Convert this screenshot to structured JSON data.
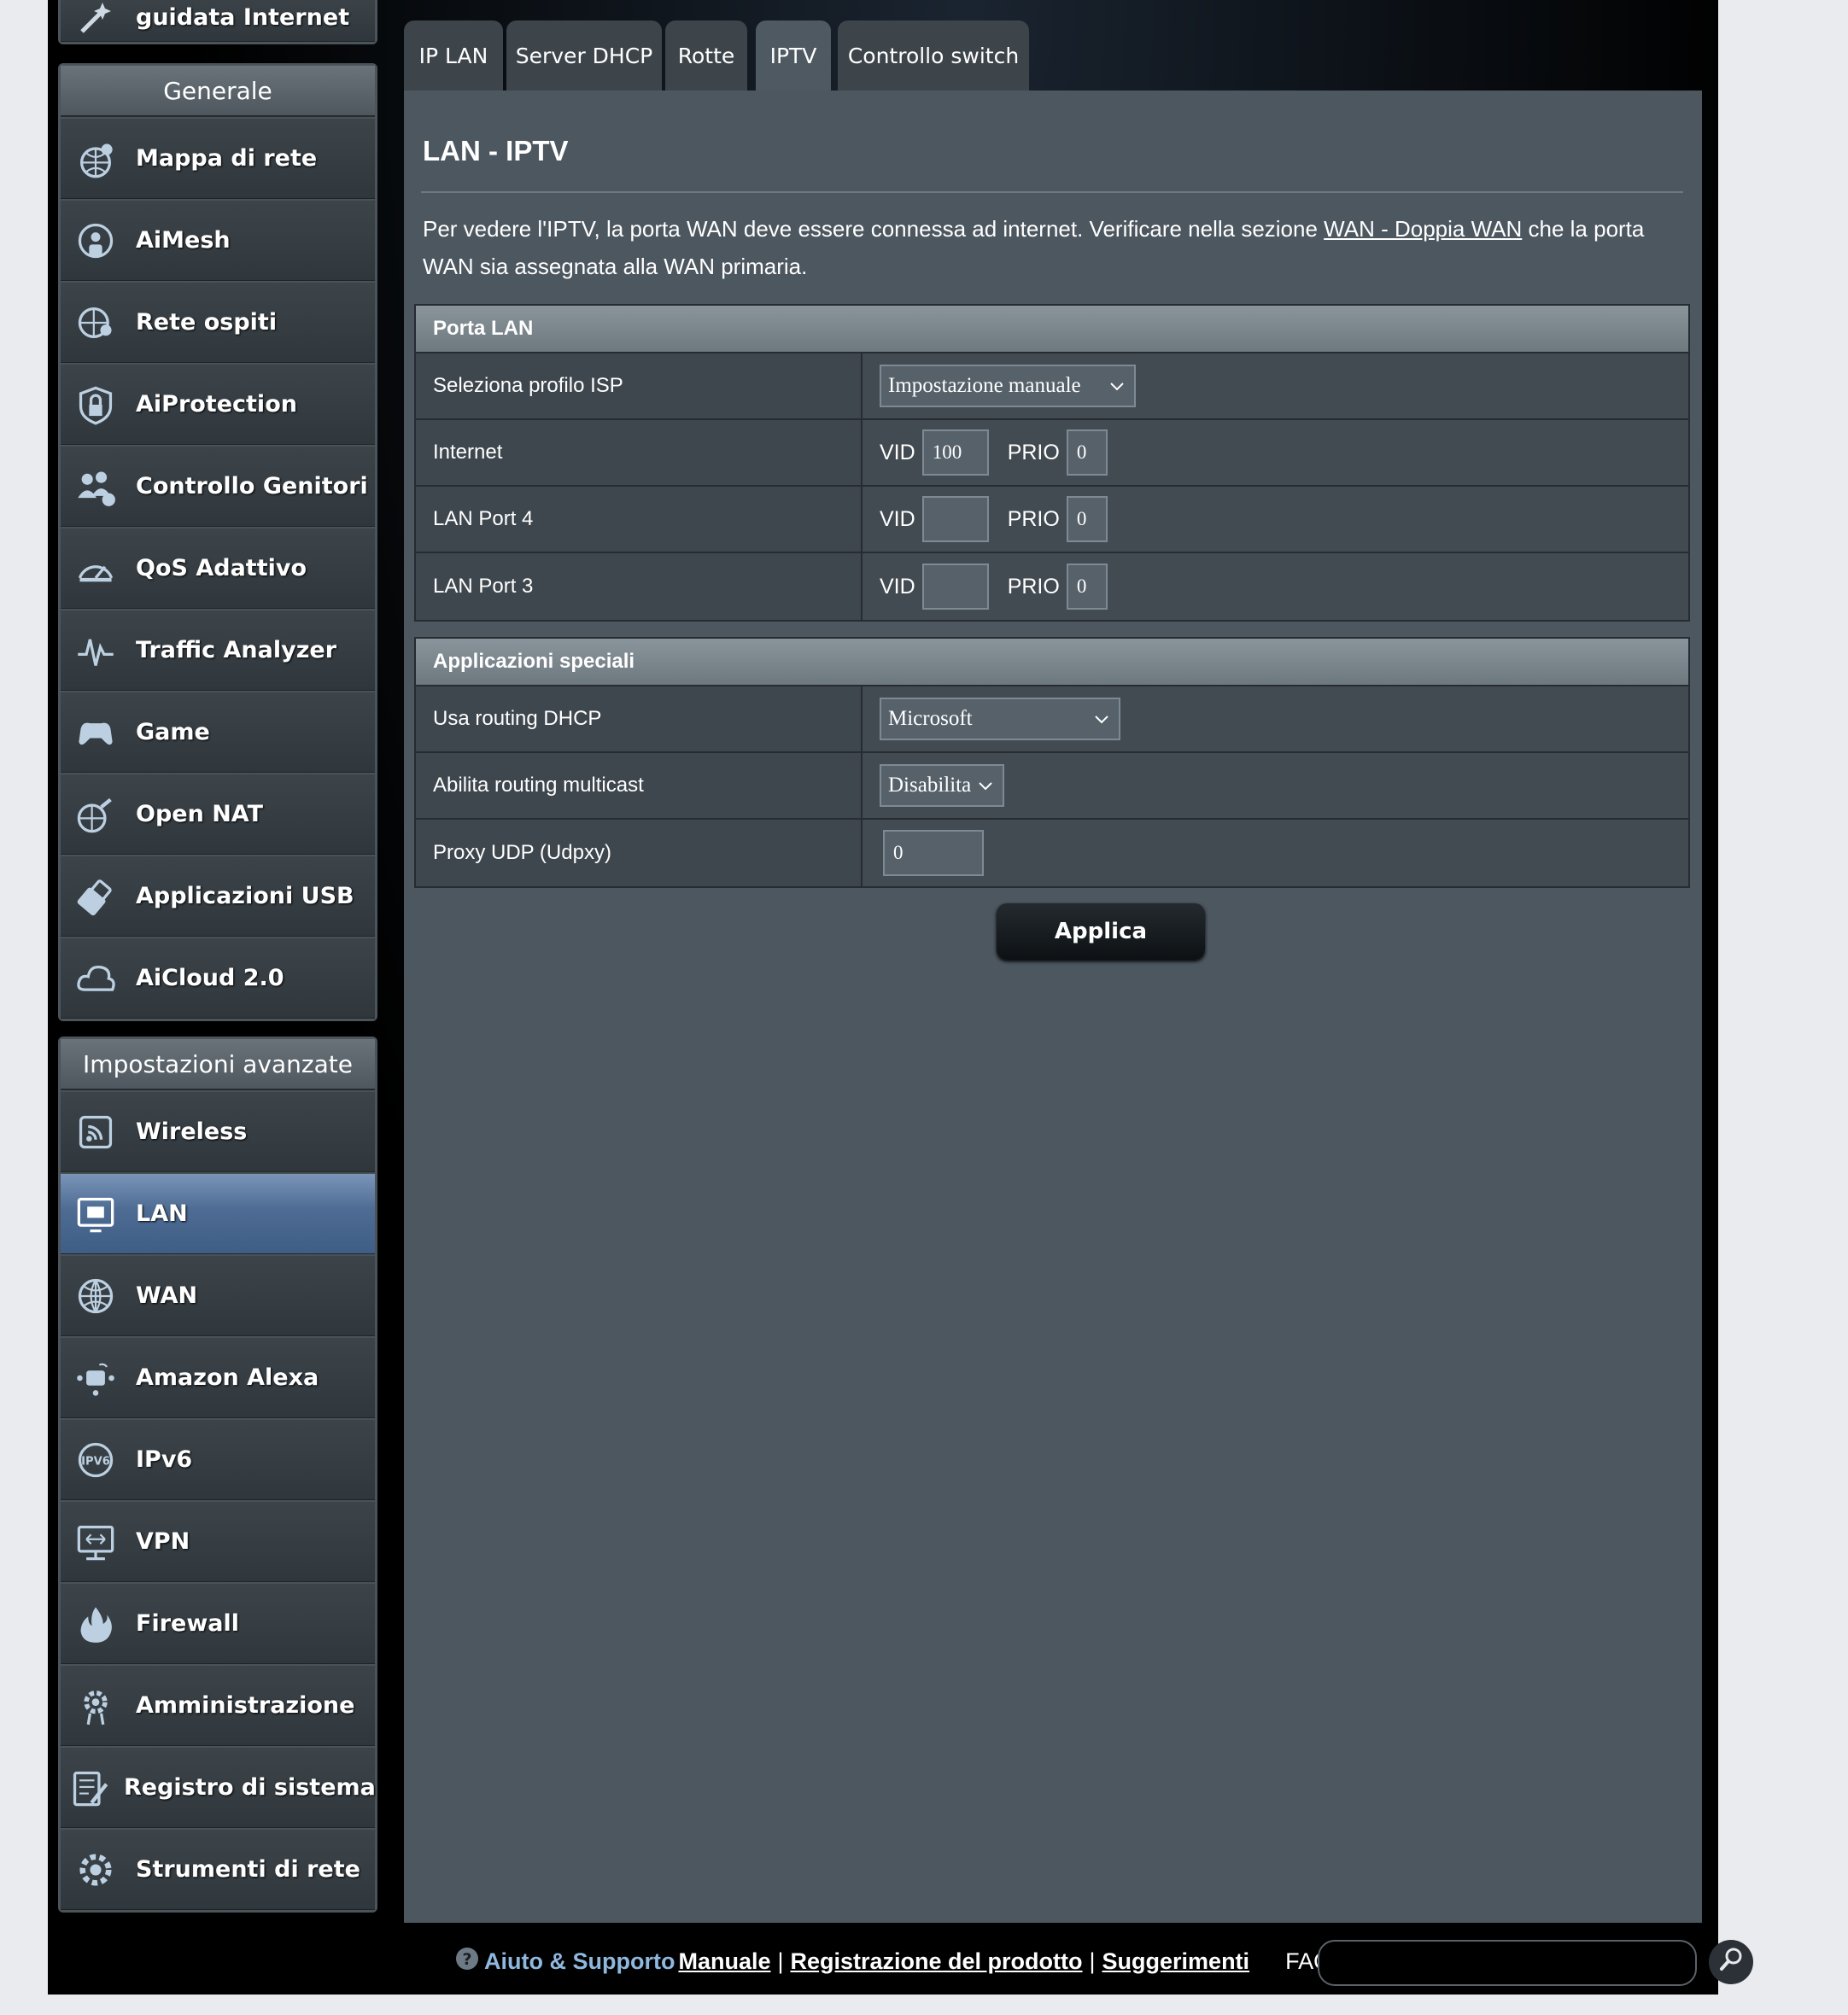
{
  "sidebar": {
    "top_item_label": "guidata Internet",
    "general_header": "Generale",
    "general_items": [
      {
        "label": "Mappa di rete",
        "icon": "network-map-icon"
      },
      {
        "label": "AiMesh",
        "icon": "aimesh-icon"
      },
      {
        "label": "Rete ospiti",
        "icon": "guest-network-icon"
      },
      {
        "label": "AiProtection",
        "icon": "aiprotection-lock-icon"
      },
      {
        "label": "Controllo Genitori",
        "icon": "parental-control-icon"
      },
      {
        "label": "QoS Adattivo",
        "icon": "qos-gauge-icon"
      },
      {
        "label": "Traffic Analyzer",
        "icon": "traffic-analyzer-icon"
      },
      {
        "label": "Game",
        "icon": "gamepad-icon"
      },
      {
        "label": "Open NAT",
        "icon": "open-nat-icon"
      },
      {
        "label": "Applicazioni USB",
        "icon": "usb-icon"
      },
      {
        "label": "AiCloud 2.0",
        "icon": "cloud-icon"
      }
    ],
    "advanced_header": "Impostazioni avanzate",
    "advanced_items": [
      {
        "label": "Wireless",
        "icon": "wireless-icon"
      },
      {
        "label": "LAN",
        "icon": "lan-icon",
        "active": true
      },
      {
        "label": "WAN",
        "icon": "wan-globe-icon"
      },
      {
        "label": "Amazon Alexa",
        "icon": "alexa-icon"
      },
      {
        "label": "IPv6",
        "icon": "ipv6-icon"
      },
      {
        "label": "VPN",
        "icon": "vpn-icon"
      },
      {
        "label": "Firewall",
        "icon": "firewall-icon"
      },
      {
        "label": "Amministrazione",
        "icon": "administration-gear-icon"
      },
      {
        "label": "Registro di sistema",
        "icon": "system-log-icon"
      },
      {
        "label": "Strumenti di rete",
        "icon": "network-tools-icon"
      }
    ]
  },
  "tabs": [
    {
      "label": "IP LAN"
    },
    {
      "label": "Server DHCP"
    },
    {
      "label": "Rotte"
    },
    {
      "label": "IPTV",
      "active": true
    },
    {
      "label": "Controllo switch"
    }
  ],
  "main": {
    "title": "LAN - IPTV",
    "description_before": "Per vedere l'IPTV, la porta WAN deve essere connessa ad internet. Verificare nella sezione ",
    "description_link": "WAN - Doppia WAN",
    "description_after": " che la porta WAN sia assegnata alla WAN primaria.",
    "porta_lan": {
      "header": "Porta LAN",
      "isp_label": "Seleziona profilo ISP",
      "isp_value": "Impostazione manuale",
      "vid_label": "VID",
      "prio_label": "PRIO",
      "rows": [
        {
          "label": "Internet",
          "vid": "100",
          "prio": "0"
        },
        {
          "label": "LAN Port 4",
          "vid": "",
          "prio": "0"
        },
        {
          "label": "LAN Port 3",
          "vid": "",
          "prio": "0"
        }
      ]
    },
    "special_apps": {
      "header": "Applicazioni speciali",
      "dhcp_label": "Usa routing DHCP",
      "dhcp_value": "Microsoft",
      "multicast_label": "Abilita routing multicast",
      "multicast_value": "Disabilita",
      "udpxy_label": "Proxy UDP (Udpxy)",
      "udpxy_value": "0"
    },
    "apply_label": "Applica"
  },
  "footer": {
    "support_label": "Aiuto & Supporto",
    "manual_link": "Manuale",
    "separator": "|",
    "registration_link": "Registrazione del prodotto",
    "suggestions_link": "Suggerimenti",
    "faq_label": "FAQ",
    "faq_placeholder": ""
  },
  "colors": {
    "panel_bg": "#4d5760",
    "active_nav": "#4d6b93",
    "support_text": "#8fb8de"
  }
}
